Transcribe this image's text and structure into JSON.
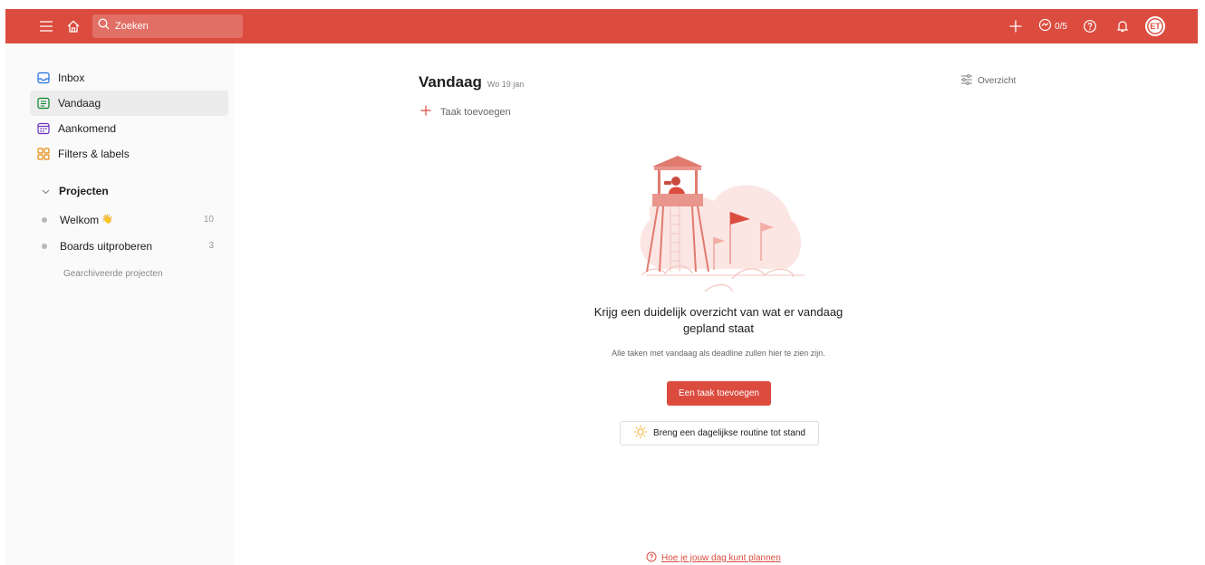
{
  "topbar": {
    "search_placeholder": "Zoeken",
    "karma": "0/5",
    "avatar_initials": "ET",
    "accent": "#db4c3f"
  },
  "sidebar": {
    "items": [
      {
        "label": "Inbox",
        "icon": "inbox-icon",
        "color": "#246fe0"
      },
      {
        "label": "Vandaag",
        "icon": "calendar-today-icon",
        "color": "#058527",
        "active": true
      },
      {
        "label": "Aankomend",
        "icon": "calendar-upcoming-icon",
        "color": "#692fc2"
      },
      {
        "label": "Filters & labels",
        "icon": "filters-icon",
        "color": "#eb8909"
      }
    ],
    "projects_header": "Projecten",
    "projects": [
      {
        "name": "Welkom",
        "emoji": "👋",
        "count": "10"
      },
      {
        "name": "Boards uitproberen",
        "count": "3"
      }
    ],
    "archived_label": "Gearchiveerde projecten"
  },
  "main": {
    "title": "Vandaag",
    "date": "Wo 19 jan",
    "view_label": "Overzicht",
    "add_task_label": "Taak toevoegen",
    "empty_title": "Krijg een duidelijk overzicht van wat er vandaag gepland staat",
    "empty_subtitle": "Alle taken met vandaag als deadline zullen hier te zien zijn.",
    "primary_button": "Een taak toevoegen",
    "routine_button": "Breng een dagelijkse routine tot stand",
    "help_link": "Hoe je jouw dag kunt plannen"
  }
}
